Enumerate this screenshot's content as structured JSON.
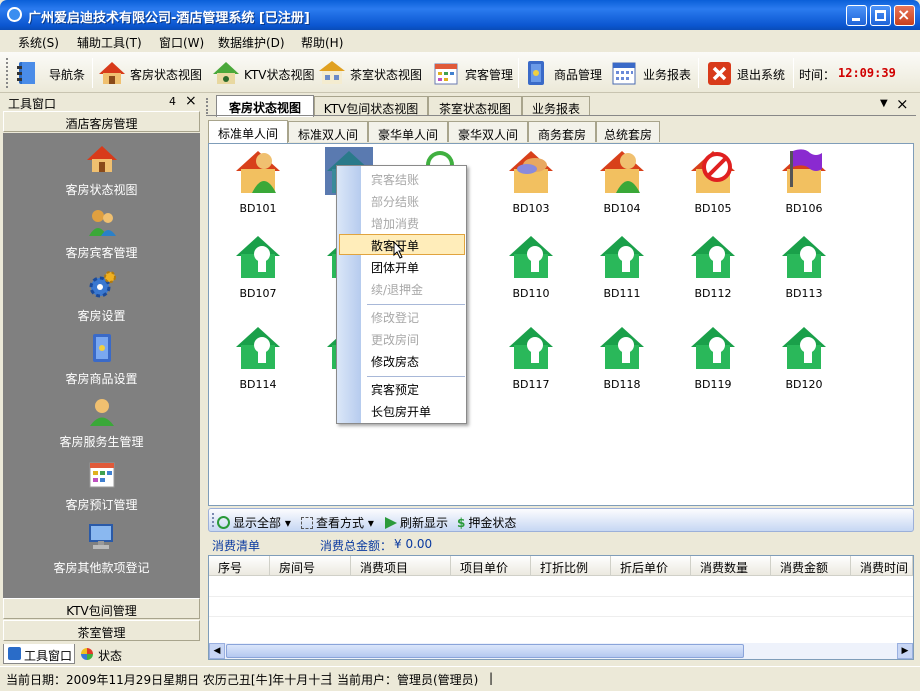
{
  "window": {
    "title": "广州爱启迪技术有限公司-酒店管理系统 [已注册]"
  },
  "menu": [
    "系统(S)",
    "辅助工具(T)",
    "窗口(W)",
    "数据维护(D)",
    "帮助(H)"
  ],
  "toolbar": {
    "nav": "导航条",
    "room_status": "客房状态视图",
    "ktv_status": "KTV状态视图",
    "tea_status": "茶室状态视图",
    "guest_mgmt": "宾客管理",
    "goods_mgmt": "商品管理",
    "reports": "业务报表",
    "exit": "退出系统",
    "time_label": "时间：",
    "time_value": "12:09:39"
  },
  "left_panel": {
    "title": "工具窗口",
    "pin": "4",
    "close": "×",
    "section_top": "酒店客房管理",
    "items": [
      "客房状态视图",
      "客房宾客管理",
      "客房设置",
      "客房商品设置",
      "客房服务生管理",
      "客房预订管理",
      "客房其他款项登记"
    ],
    "section_ktv": "KTV包间管理",
    "section_tea": "茶室管理",
    "tabs": [
      "工具窗口",
      "状态"
    ]
  },
  "main_tabs": [
    "客房状态视图",
    "KTV包间状态视图",
    "茶室状态视图",
    "业务报表"
  ],
  "room_type_tabs": [
    "标准单人间",
    "标准双人间",
    "豪华单人间",
    "豪华双人间",
    "商务套房",
    "总统套房"
  ],
  "rooms": {
    "r1": [
      "BD101",
      "",
      "",
      "BD103",
      "BD104",
      "BD105",
      "BD106"
    ],
    "r2": [
      "BD107",
      "B",
      "",
      "BD110",
      "BD111",
      "BD112",
      "BD113"
    ],
    "r3": [
      "BD114",
      "B",
      "",
      "BD117",
      "BD118",
      "BD119",
      "BD120"
    ]
  },
  "context_menu": {
    "items": [
      "宾客结账",
      "部分结账",
      "增加消费",
      "散客开单",
      "团体开单",
      "续/退押金",
      "修改登记",
      "更改房间",
      "修改房态",
      "宾客预定",
      "长包房开单"
    ],
    "highlighted": "散客开单"
  },
  "bottom_toolbar": {
    "show_all": "显示全部",
    "view_mode": "查看方式",
    "refresh": "刷新显示",
    "deposit": "押金状态"
  },
  "consumption": {
    "list_label": "消费清单",
    "total_label": "消费总金额：",
    "total_value": "¥ 0.00"
  },
  "table_headers": [
    "序号",
    "房间号",
    "消费项目",
    "项目单价",
    "打折比例",
    "折后单价",
    "消费数量",
    "消费金额",
    "消费时间"
  ],
  "status_bar": {
    "date": "当前日期：2009年11月29日星期日 农历己丑[牛]年十月十三",
    "user": "当前用户：管理员(管理员)"
  },
  "colors": {
    "title": "#0a5fd8",
    "clock": "#d00000",
    "panel_bg": "#808080",
    "highlight": "#ffedba"
  }
}
